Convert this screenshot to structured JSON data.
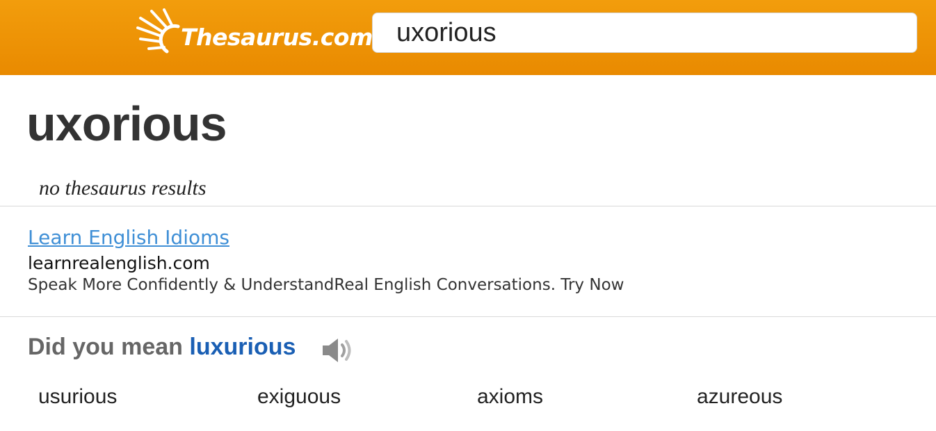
{
  "header": {
    "logo_text": "Thesaurus.com",
    "logo_icon": "sun-rays-icon",
    "search_value": "uxorious",
    "brand_color": "#ee960a"
  },
  "main": {
    "title": "uxorious",
    "no_results": "no thesaurus results"
  },
  "ad": {
    "title": "Learn English Idioms",
    "domain": "learnrealenglish.com",
    "description": "Speak More Confidently & UnderstandReal English Conversations. Try Now"
  },
  "suggestion": {
    "prefix": "Did you mean ",
    "word": "luxurious",
    "audio_icon": "speaker-icon"
  },
  "alternatives": [
    "usurious",
    "exiguous",
    "axioms",
    "azureous"
  ]
}
